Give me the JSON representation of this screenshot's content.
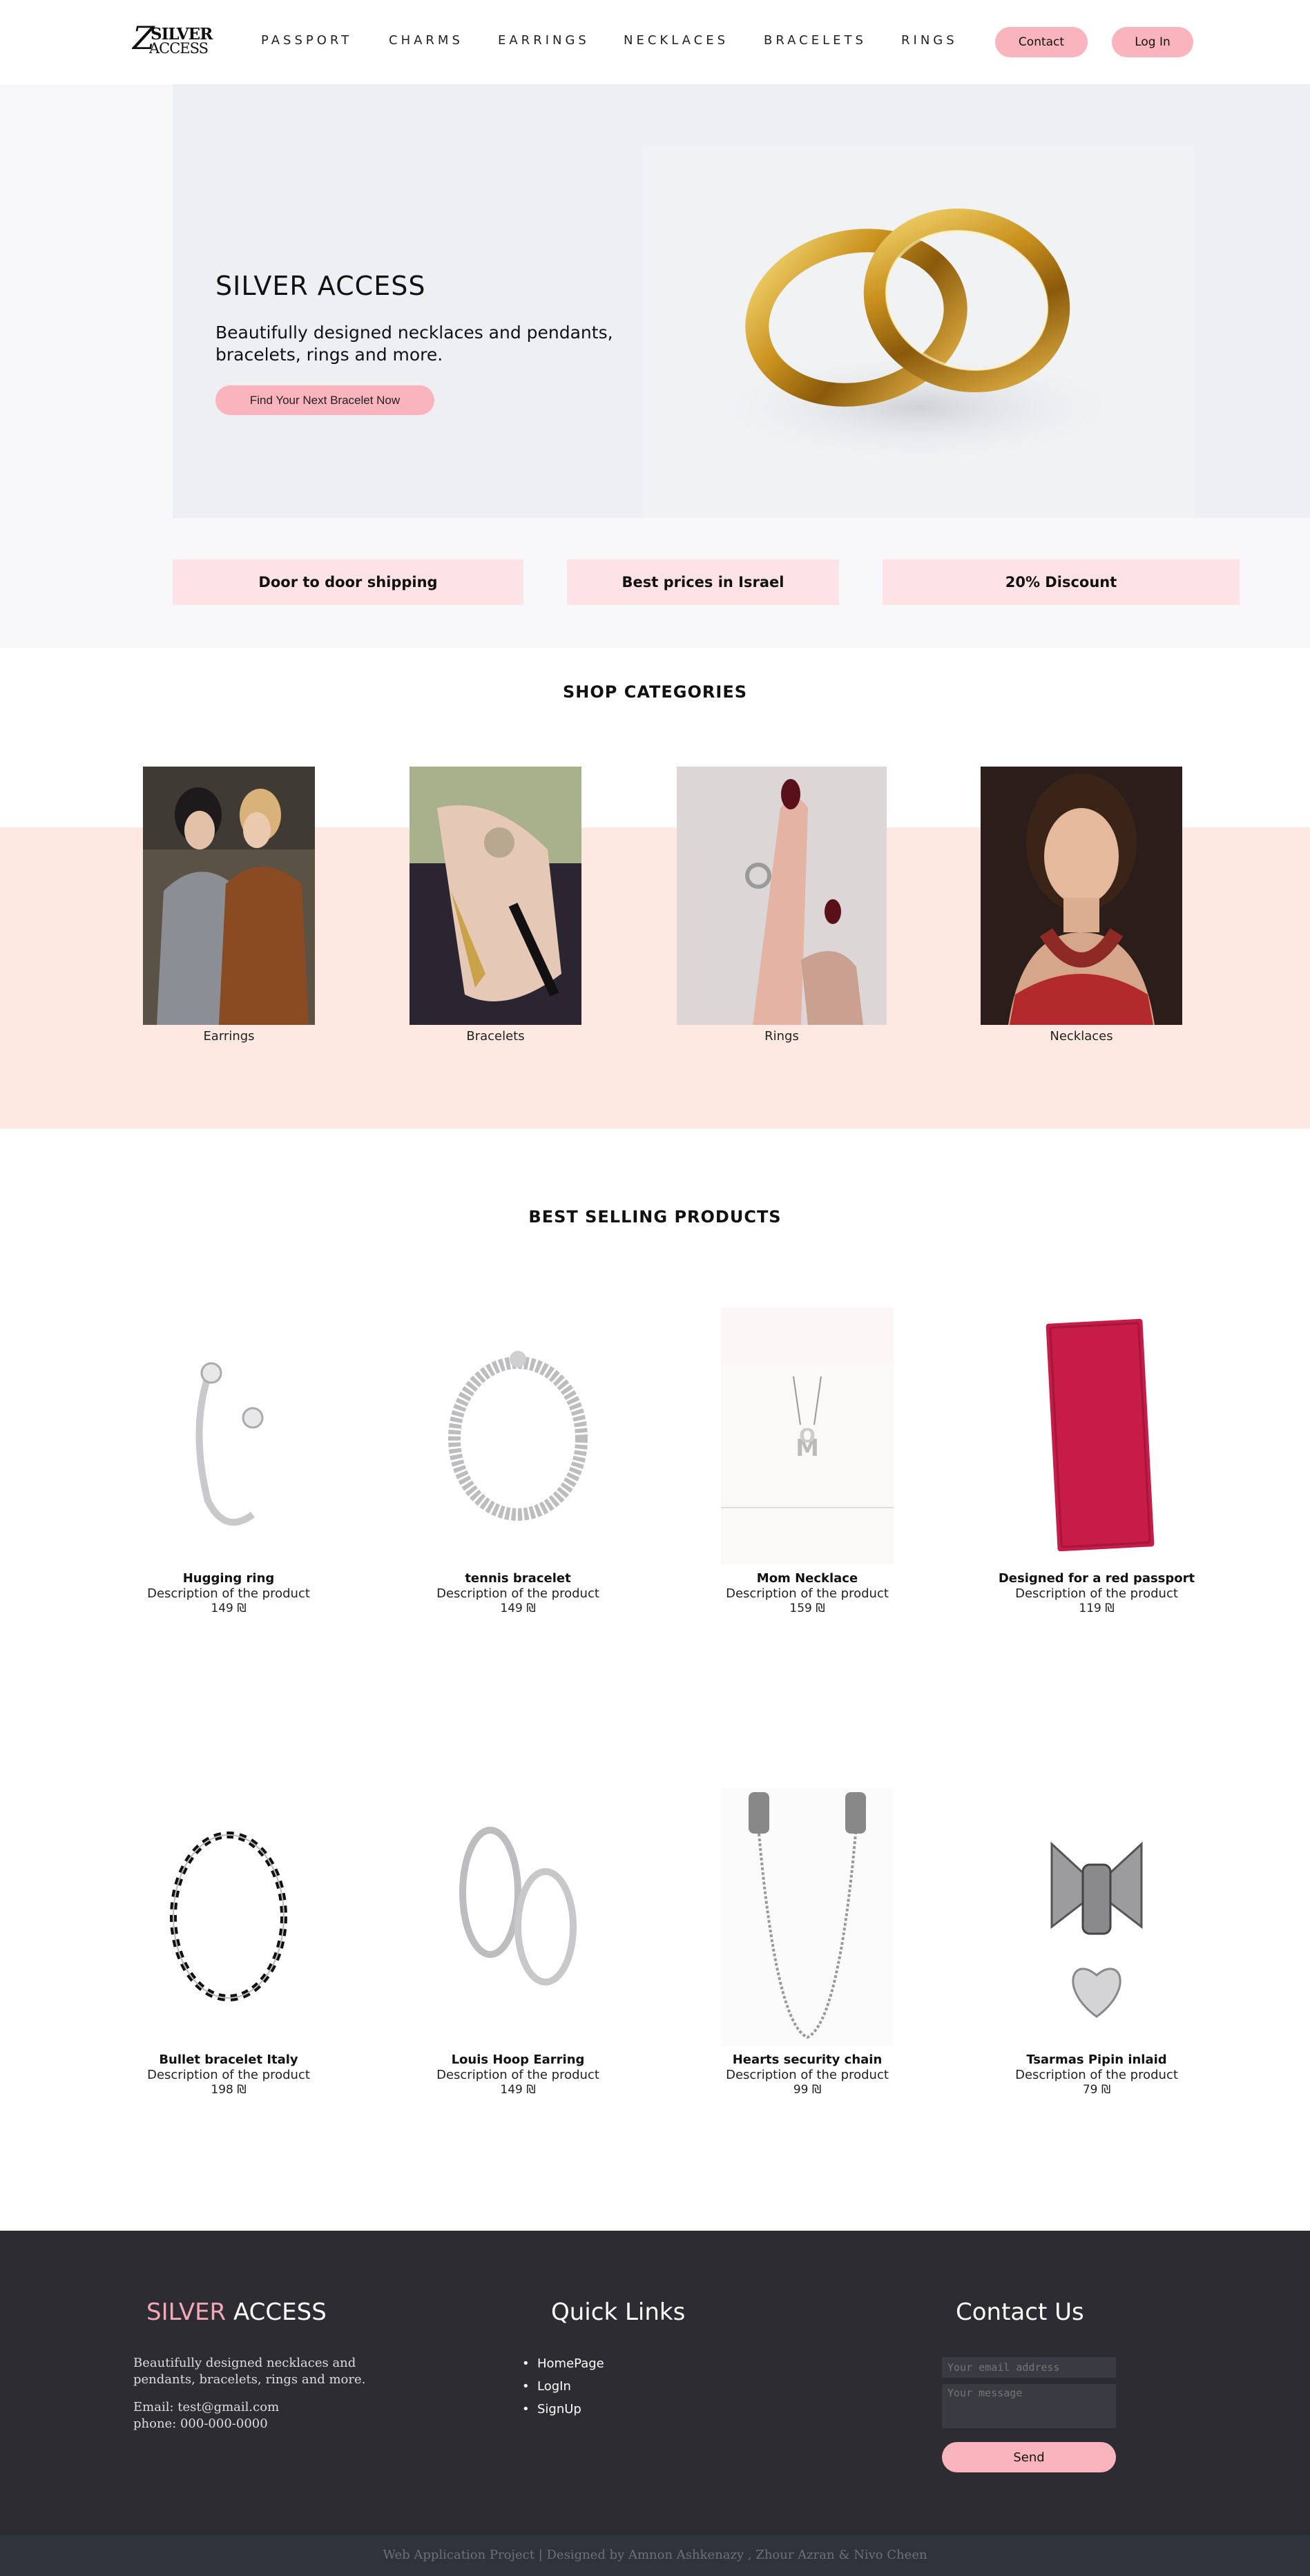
{
  "header": {
    "logo": {
      "z": "Z",
      "line1": "SILVER",
      "line2": "ACCESS"
    },
    "nav": [
      "PASSPORT",
      "CHARMS",
      "EARRINGS",
      "NECKLACES",
      "BRACELETS",
      "RINGS"
    ],
    "contact_label": "Contact",
    "login_label": "Log In"
  },
  "hero": {
    "title": "SILVER ACCESS",
    "subtitle": "Beautifully designed necklaces and pendants, bracelets, rings and more.",
    "button_label": "Find Your Next Bracelet Now"
  },
  "features": [
    "Door to door shipping",
    "Best prices in Israel",
    "20% Discount"
  ],
  "categories": {
    "title": "SHOP CATEGORIES",
    "items": [
      "Earrings",
      "Bracelets",
      "Rings",
      "Necklaces"
    ]
  },
  "products": {
    "title": "BEST SELLING PRODUCTS",
    "items": [
      {
        "name": "Hugging ring",
        "description": "Description of the product",
        "price": "149 ₪"
      },
      {
        "name": "tennis bracelet",
        "description": "Description of the product",
        "price": "149 ₪"
      },
      {
        "name": "Mom Necklace",
        "description": "Description of the product",
        "price": "159 ₪"
      },
      {
        "name": "Designed for a red passport",
        "description": "Description of the product",
        "price": "119 ₪"
      },
      {
        "name": "Bullet bracelet Italy",
        "description": "Description of the product",
        "price": "198 ₪"
      },
      {
        "name": "Louis Hoop Earring",
        "description": "Description of the product",
        "price": "149 ₪"
      },
      {
        "name": "Hearts security chain",
        "description": "Description of the product",
        "price": "99 ₪"
      },
      {
        "name": "Tsarmas Pipin inlaid",
        "description": "Description of the product",
        "price": "79 ₪"
      }
    ]
  },
  "footer": {
    "brand_pink": "SILVER",
    "brand_white": "ACCESS",
    "about": "Beautifully designed necklaces and pendants, bracelets, rings and more.",
    "email": "Email: test@gmail.com",
    "phone": "phone: 000-000-0000",
    "quick_links_title": "Quick Links",
    "links": [
      "HomePage",
      "LogIn",
      "SignUp"
    ],
    "contact_title": "Contact Us",
    "email_placeholder": "Your email address",
    "message_placeholder": "Your message",
    "send_label": "Send",
    "credits": "Web Application Project | Designed by Amnon Ashkenazy , Zhour Azran & Nivo Cheen"
  },
  "colors": {
    "accent_pink": "#f9b4bd",
    "feature_bg": "#fde3e5",
    "category_band": "#fde8e2",
    "footer_bg": "#2d2c33"
  },
  "icons": [
    "logo-mark"
  ]
}
